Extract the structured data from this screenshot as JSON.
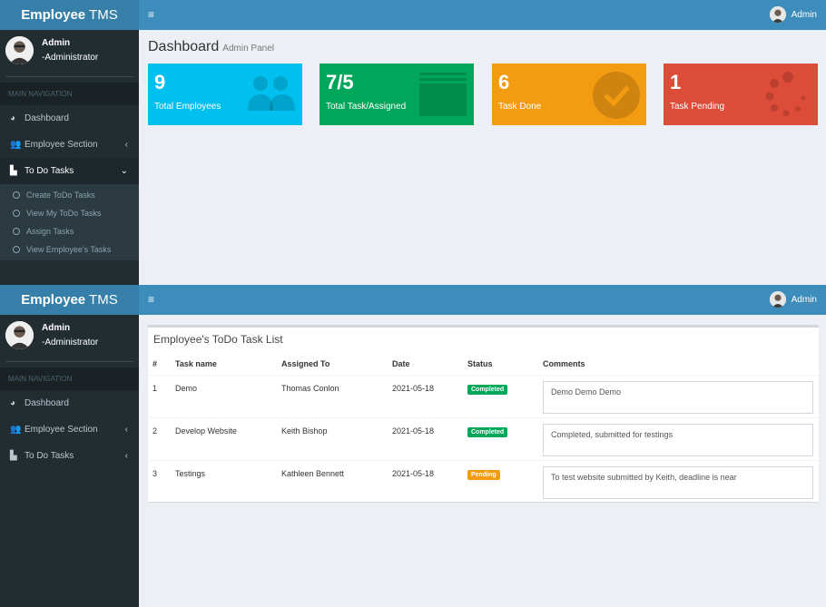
{
  "app": {
    "logo_bold": "Employee",
    "logo_rest": " TMS"
  },
  "header": {
    "toggle_icon": "≡",
    "user_label": "Admin"
  },
  "sidebar_user": {
    "name": "Admin",
    "role": "-Administrator"
  },
  "nav": {
    "header": "MAIN NAVIGATION",
    "dashboard": "Dashboard",
    "employee_section": "Employee Section",
    "todo_tasks": "To Do Tasks",
    "sub": [
      "Create ToDo Tasks",
      "View My ToDo Tasks",
      "Assign Tasks",
      "View Employee's Tasks"
    ]
  },
  "dashboard": {
    "title": "Dashboard",
    "subtitle": "Admin Panel",
    "boxes": [
      {
        "value": "9",
        "label": "Total Employees",
        "color": "#00c0ef",
        "icon": "users-icon"
      },
      {
        "value": "7/5",
        "label": "Total Task/Assigned",
        "color": "#00a65a",
        "icon": "tasks-icon"
      },
      {
        "value": "6",
        "label": "Task Done",
        "color": "#f39c12",
        "icon": "check-circle-icon"
      },
      {
        "value": "1",
        "label": "Task Pending",
        "color": "#dd4b39",
        "icon": "spinner-icon"
      }
    ]
  },
  "task_list": {
    "title": "Employee's ToDo Task List",
    "columns": [
      "#",
      "Task name",
      "Assigned To",
      "Date",
      "Status",
      "Comments"
    ],
    "rows": [
      {
        "num": "1",
        "task": "Demo",
        "assigned": "Thomas Conlon",
        "date": "2021-05-18",
        "status": "Completed",
        "comment": "Demo Demo Demo"
      },
      {
        "num": "2",
        "task": "Develop Website",
        "assigned": "Keith Bishop",
        "date": "2021-05-18",
        "status": "Completed",
        "comment": "Completed, submitted for testings"
      },
      {
        "num": "3",
        "task": "Testings",
        "assigned": "Kathleen Bennett",
        "date": "2021-05-18",
        "status": "Pending",
        "comment": "To test website submitted by Keith, deadline is near"
      }
    ]
  }
}
